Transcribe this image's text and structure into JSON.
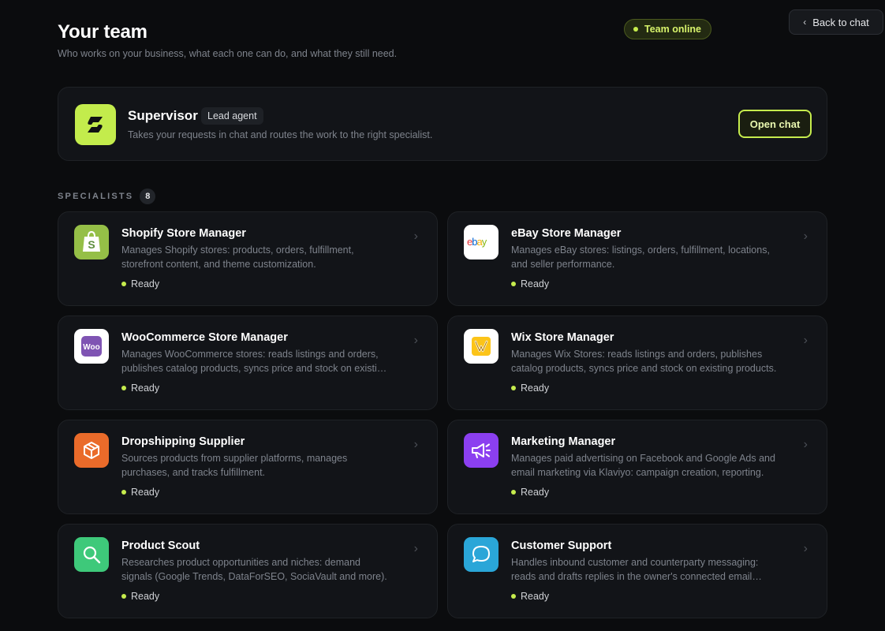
{
  "header": {
    "title": "Your team",
    "subtitle": "Who works on your business, what each one can do, and what they still need.",
    "status": "Team online",
    "back_label": "Back to chat"
  },
  "supervisor": {
    "name": "Supervisor",
    "badge": "Lead agent",
    "description": "Takes your requests in chat and routes the work to the right specialist.",
    "cta": "Open chat"
  },
  "specialists_section": {
    "label": "SPECIALISTS",
    "count": "8"
  },
  "specialists": [
    {
      "name": "Shopify Store Manager",
      "description": "Manages Shopify stores: products, orders, fulfillment, storefront content, and theme customization.",
      "status": "Ready",
      "icon": "shopify-icon",
      "color": "#95bf47"
    },
    {
      "name": "eBay Store Manager",
      "description": "Manages eBay stores: listings, orders, fulfillment, locations, and seller performance.",
      "status": "Ready",
      "icon": "ebay-icon",
      "color": "#ffffff"
    },
    {
      "name": "WooCommerce Store Manager",
      "description": "Manages WooCommerce stores: reads listings and orders, publishes catalog products, syncs price and stock on existing products.",
      "status": "Ready",
      "icon": "woocommerce-icon",
      "color": "#ffffff"
    },
    {
      "name": "Wix Store Manager",
      "description": "Manages Wix Stores: reads listings and orders, publishes catalog products, syncs price and stock on existing products.",
      "status": "Ready",
      "icon": "wix-icon",
      "color": "#ffffff"
    },
    {
      "name": "Dropshipping Supplier",
      "description": "Sources products from supplier platforms, manages purchases, and tracks fulfillment.",
      "status": "Ready",
      "icon": "package-icon",
      "color": "#ea6b2a"
    },
    {
      "name": "Marketing Manager",
      "description": "Manages paid advertising on Facebook and Google Ads and email marketing via Klaviyo: campaign creation, reporting.",
      "status": "Ready",
      "icon": "megaphone-icon",
      "color": "#8b3ff0"
    },
    {
      "name": "Product Scout",
      "description": "Researches product opportunities and niches: demand signals (Google Trends, DataForSEO, SociaVault and more).",
      "status": "Ready",
      "icon": "search-icon",
      "color": "#3ec97a"
    },
    {
      "name": "Customer Support",
      "description": "Handles inbound customer and counterparty messaging: reads and drafts replies in the owner's connected email inbox.",
      "status": "Ready",
      "icon": "chat-bubble-icon",
      "color": "#2aa6d8"
    }
  ],
  "colors": {
    "accent": "#c6ec4d",
    "background": "#0b0c0e",
    "card": "#121418"
  }
}
